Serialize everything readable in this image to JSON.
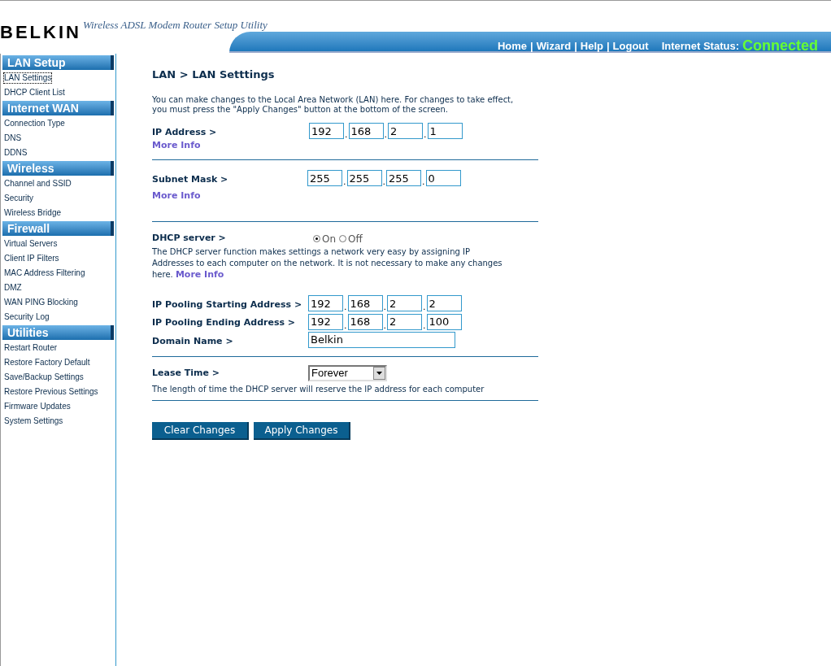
{
  "header": {
    "logo": "BELKIN",
    "tagline": "Wireless ADSL Modem Router Setup Utility",
    "nav": [
      "Home",
      "Wizard",
      "Help",
      "Logout"
    ],
    "separator": "|",
    "status_label": "Internet Status:",
    "status_value": "Connected"
  },
  "sidebar": [
    {
      "title": "LAN Setup",
      "items": [
        {
          "label": "LAN Settings",
          "selected": true
        },
        {
          "label": "DHCP Client List",
          "selected": false
        }
      ]
    },
    {
      "title": "Internet WAN",
      "items": [
        {
          "label": "Connection Type",
          "selected": false
        },
        {
          "label": "DNS",
          "selected": false
        },
        {
          "label": "DDNS",
          "selected": false
        }
      ]
    },
    {
      "title": "Wireless",
      "items": [
        {
          "label": "Channel and SSID",
          "selected": false
        },
        {
          "label": "Security",
          "selected": false
        },
        {
          "label": "Wireless Bridge",
          "selected": false
        }
      ]
    },
    {
      "title": "Firewall",
      "items": [
        {
          "label": "Virtual Servers",
          "selected": false
        },
        {
          "label": "Client IP Filters",
          "selected": false
        },
        {
          "label": "MAC Address Filtering",
          "selected": false
        },
        {
          "label": "DMZ",
          "selected": false
        },
        {
          "label": "WAN PING Blocking",
          "selected": false
        },
        {
          "label": "Security Log",
          "selected": false
        }
      ]
    },
    {
      "title": "Utilities",
      "items": [
        {
          "label": "Restart Router",
          "selected": false
        },
        {
          "label": "Restore Factory Default",
          "selected": false
        },
        {
          "label": "Save/Backup Settings",
          "selected": false
        },
        {
          "label": "Restore Previous Settings",
          "selected": false
        },
        {
          "label": "Firmware Updates",
          "selected": false
        },
        {
          "label": "System Settings",
          "selected": false
        }
      ]
    }
  ],
  "main": {
    "octet_separator": ".",
    "title": "LAN > LAN Setttings",
    "intro": "You can make changes to the Local Area Network (LAN) here. For changes to take effect, you must press the \"Apply Changes\" button at the bottom of the screen.",
    "ip_address": {
      "label": "IP Address >",
      "octets": [
        "192",
        "168",
        "2",
        "1"
      ],
      "more_info": "More Info"
    },
    "subnet_mask": {
      "label": "Subnet Mask >",
      "octets": [
        "255",
        "255",
        "255",
        "0"
      ],
      "more_info": "More Info"
    },
    "dhcp": {
      "label": "DHCP server >",
      "options": [
        {
          "label": "On",
          "selected": true
        },
        {
          "label": "Off",
          "selected": false
        }
      ],
      "description": "The DHCP server function makes settings a network very easy by assigning IP Addresses to each computer on the network. It is not necessary to make any changes here.",
      "more_info": "More Info"
    },
    "pool_start": {
      "label": "IP Pooling Starting Address >",
      "octets": [
        "192",
        "168",
        "2",
        "2"
      ]
    },
    "pool_end": {
      "label": "IP Pooling Ending Address >",
      "octets": [
        "192",
        "168",
        "2",
        "100"
      ]
    },
    "domain": {
      "label": "Domain Name >",
      "value": "Belkin"
    },
    "lease": {
      "label": "Lease Time >",
      "value": "Forever",
      "description": "The length of time the DHCP server will reserve the IP address for each computer"
    },
    "buttons": [
      "Clear Changes",
      "Apply Changes"
    ]
  }
}
